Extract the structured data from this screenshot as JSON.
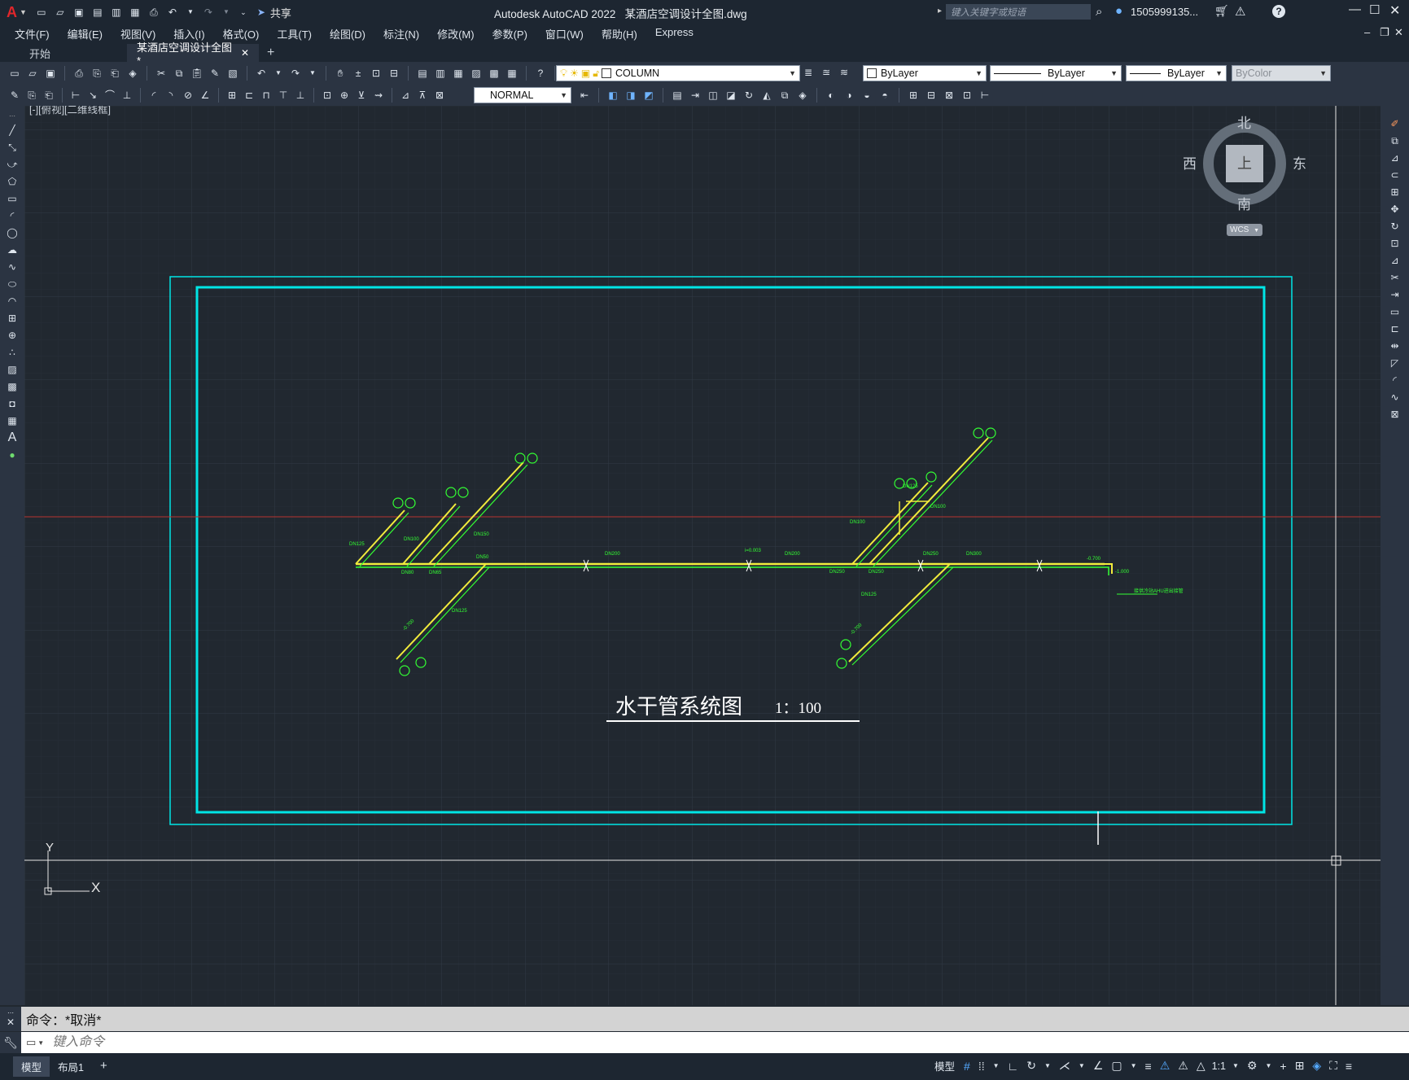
{
  "app": {
    "logo": "A",
    "title": "Autodesk AutoCAD 2022",
    "filename": "某酒店空调设计全图.dwg",
    "share_label": "共享",
    "search_placeholder": "键入关键字或短语",
    "user": "1505999135...",
    "window_controls": [
      "minimize-icon",
      "maximize-icon",
      "close-icon"
    ]
  },
  "menu": [
    "文件(F)",
    "编辑(E)",
    "视图(V)",
    "插入(I)",
    "格式(O)",
    "工具(T)",
    "绘图(D)",
    "标注(N)",
    "修改(M)",
    "参数(P)",
    "窗口(W)",
    "帮助(H)",
    "Express"
  ],
  "tabs": [
    {
      "label": "开始",
      "active": false
    },
    {
      "label": "某酒店空调设计全图*",
      "active": true
    }
  ],
  "toolbar": {
    "layer": "COLUMN",
    "color": "ByLayer",
    "linetype": "ByLayer",
    "lineweight": "ByLayer",
    "plotstyle": "ByColor",
    "textstyle": "NORMAL"
  },
  "viewport": {
    "label": "[-][俯视][二维线框]",
    "viewcube": {
      "north": "北",
      "south": "南",
      "east": "东",
      "west": "西",
      "top": "上",
      "wcs": "WCS"
    },
    "ucs": {
      "x": "X",
      "y": "Y"
    }
  },
  "drawing": {
    "title": "水干管系统图",
    "scale": "1：100",
    "labels": [
      "DN125",
      "DN100",
      "DN80",
      "DN65",
      "DN50",
      "DN150",
      "DN200",
      "DN250",
      "DN300",
      "-0.700",
      "-1.000",
      "i=0.003",
      "-0.700",
      "-0.700"
    ],
    "colors": {
      "frame": "#00e5e5",
      "pipe_supply": "#f2ec3c",
      "pipe_return": "#33ff33",
      "title": "#ffffff",
      "crosshair_h": "#b8332f"
    }
  },
  "command": {
    "history": "命令：*取消*",
    "placeholder": "键入命令"
  },
  "status": {
    "layouts": [
      "模型",
      "布局1"
    ],
    "model_label": "模型",
    "scale": "1:1"
  }
}
